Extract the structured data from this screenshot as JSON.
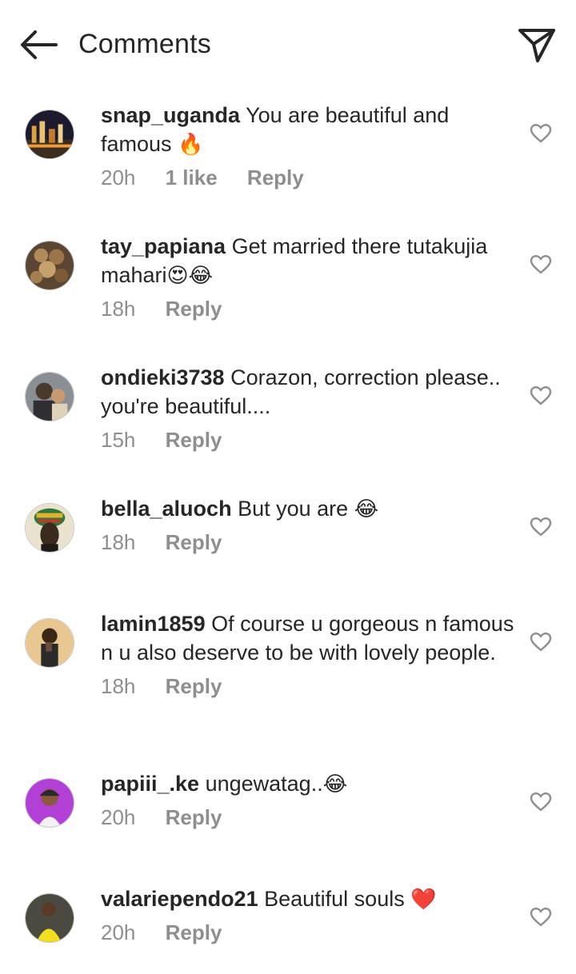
{
  "header": {
    "title": "Comments",
    "back_icon": "arrow-left-icon",
    "share_icon": "paper-plane-icon"
  },
  "comments": [
    {
      "username": "snap_uganda",
      "text": "You are beautiful and famous",
      "emoji": "🔥",
      "time": "20h",
      "likes": "1 like",
      "reply": "Reply"
    },
    {
      "username": "tay_papiana",
      "text": "Get married there tutakujia mahari",
      "emoji": "😍😂",
      "time": "18h",
      "reply": "Reply"
    },
    {
      "username": "ondieki3738",
      "text": "Corazon, correction please.. you're beautiful....",
      "time": "15h",
      "reply": "Reply"
    },
    {
      "username": "bella_aluoch",
      "text": "But you are",
      "emoji": "😂",
      "time": "18h",
      "reply": "Reply"
    },
    {
      "username": "lamin1859",
      "text": "Of course u gorgeous n famous n u also deserve to be with lovely people.",
      "time": "18h",
      "reply": "Reply"
    },
    {
      "username": "papiii_.ke",
      "text": "ungewatag..",
      "emoji": "😂",
      "time": "20h",
      "reply": "Reply"
    },
    {
      "username": "valariependo21",
      "text": "Beautiful souls",
      "emoji": "❤️",
      "time": "20h",
      "reply": "Reply"
    }
  ],
  "colors": {
    "text": "#262626",
    "secondary": "#8e8e8e",
    "heart_outline": "#8e8e8e"
  }
}
